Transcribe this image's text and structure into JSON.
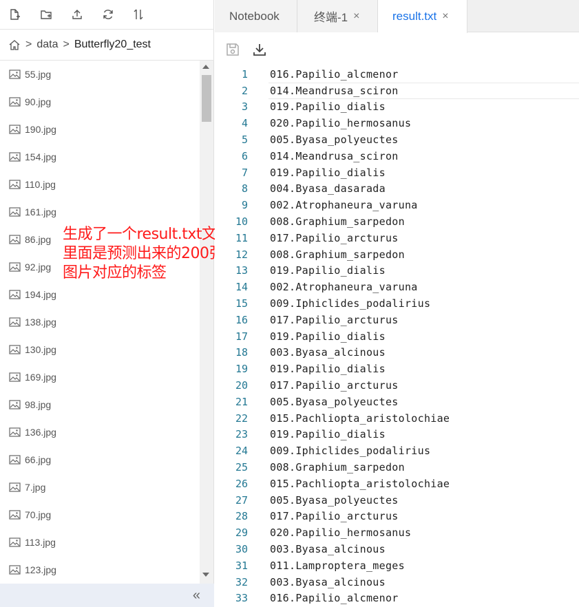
{
  "toolbar": {
    "icons": [
      "new-file-icon",
      "new-folder-icon",
      "upload-icon",
      "refresh-icon",
      "sort-icon"
    ]
  },
  "breadcrumb": {
    "home_icon": "home-icon",
    "sep1": ">",
    "folder": "data",
    "sep2": ">",
    "current": "Butterfly20_test"
  },
  "files": [
    "55.jpg",
    "90.jpg",
    "190.jpg",
    "154.jpg",
    "110.jpg",
    "161.jpg",
    "86.jpg",
    "92.jpg",
    "194.jpg",
    "138.jpg",
    "130.jpg",
    "169.jpg",
    "98.jpg",
    "136.jpg",
    "66.jpg",
    "7.jpg",
    "70.jpg",
    "113.jpg",
    "123.jpg"
  ],
  "sidebar": {
    "collapse_label": "«"
  },
  "annotation": {
    "lines": [
      "生成了一个result.txt文件",
      "里面是预测出来的200张",
      "图片对应的标签"
    ],
    "color": "#ff1a1a"
  },
  "tabs": [
    {
      "label": "Notebook",
      "closable": false
    },
    {
      "label": "终端-1",
      "close": "×"
    },
    {
      "label": "result.txt",
      "close": "×",
      "active": true
    }
  ],
  "editor": {
    "toolbar_icons": [
      "save-icon",
      "download-icon"
    ],
    "lines": [
      "016.Papilio_alcmenor",
      "014.Meandrusa_sciron",
      "019.Papilio_dialis",
      "020.Papilio_hermosanus",
      "005.Byasa_polyeuctes",
      "014.Meandrusa_sciron",
      "019.Papilio_dialis",
      "004.Byasa_dasarada",
      "002.Atrophaneura_varuna",
      "008.Graphium_sarpedon",
      "017.Papilio_arcturus",
      "008.Graphium_sarpedon",
      "019.Papilio_dialis",
      "002.Atrophaneura_varuna",
      "009.Iphiclides_podalirius",
      "017.Papilio_arcturus",
      "019.Papilio_dialis",
      "003.Byasa_alcinous",
      "019.Papilio_dialis",
      "017.Papilio_arcturus",
      "005.Byasa_polyeuctes",
      "015.Pachliopta_aristolochiae",
      "019.Papilio_dialis",
      "009.Iphiclides_podalirius",
      "008.Graphium_sarpedon",
      "015.Pachliopta_aristolochiae",
      "005.Byasa_polyeuctes",
      "017.Papilio_arcturus",
      "020.Papilio_hermosanus",
      "003.Byasa_alcinous",
      "011.Lamproptera_meges",
      "003.Byasa_alcinous",
      "016.Papilio_alcmenor"
    ]
  },
  "colors": {
    "accent": "#1a73e8",
    "line_number": "#237893",
    "annotation": "#ff1a1a"
  }
}
